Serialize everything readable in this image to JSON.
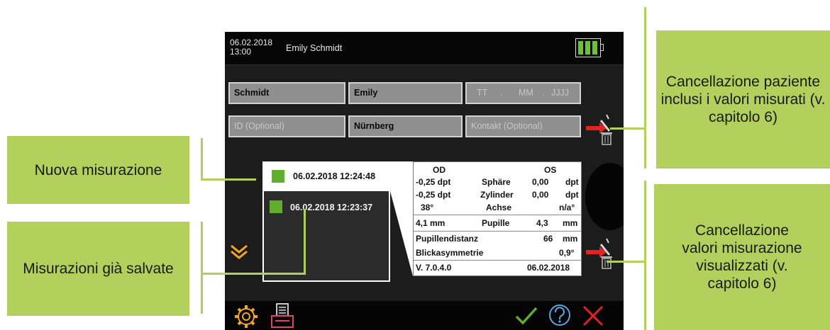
{
  "status_bar": {
    "date": "06.02.2018",
    "time": "13:00",
    "patient_name": "Emily Schmidt",
    "battery_level": 1.0
  },
  "form": {
    "last_name": "Schmidt",
    "first_name": "Emily",
    "birthdate_day_placeholder": "TT",
    "birthdate_month_placeholder": "MM",
    "birthdate_year_placeholder": "JJJJ",
    "date_separator": ".",
    "id_placeholder": "ID (Optional)",
    "city": "Nürnberg",
    "contact_placeholder": "Kontakt (Optional)"
  },
  "measurements": {
    "new": "06.02.2018 12:24:48",
    "saved": [
      "06.02.2018 12:23:37"
    ]
  },
  "values": {
    "header_od": "OD",
    "header_os": "OS",
    "rows": [
      {
        "od": "-0,25 dpt",
        "label": "Sphäre",
        "os_val": "0,00",
        "os_unit": "dpt"
      },
      {
        "od": "-0,25 dpt",
        "label": "Zylinder",
        "os_val": "0,00",
        "os_unit": "dpt"
      },
      {
        "od": "38°",
        "label": "Achse",
        "os_val": "",
        "os_unit": "n/a°"
      },
      {
        "od": "4,1   mm",
        "label": "Pupille",
        "os_val": "4,3",
        "os_unit": "mm"
      }
    ],
    "pd_label": "Pupillendistanz",
    "pd_val": "66",
    "pd_unit": "mm",
    "asym_label": "Blickasymmetrie",
    "asym_val": "0,9°",
    "version": "V. 7.0.4.0",
    "date": "06.02.2018"
  },
  "callouts": {
    "new_measurement": "Nuova misurazione",
    "saved_measurements": "Misurazioni già salvate",
    "delete_patient": "Cancellazione paziente inclusi i valori misurati (v. capitolo 6)",
    "delete_values": "Cancellazione valori misurazione visualizzati (v. capitolo 6)"
  },
  "icons": {
    "expand": "chevron-double-down-icon",
    "settings": "gear-icon",
    "print": "printer-icon",
    "confirm": "checkmark-icon",
    "help": "help-icon",
    "cancel": "close-icon",
    "delete_patient": "trash-icon",
    "delete_values": "trash-icon"
  },
  "colors": {
    "accent_green": "#63ad2c",
    "callout_green": "#b3cf5c",
    "arrow_red": "#e32222",
    "chevron_orange": "#f5a623",
    "icon_pink": "#e0426e"
  }
}
